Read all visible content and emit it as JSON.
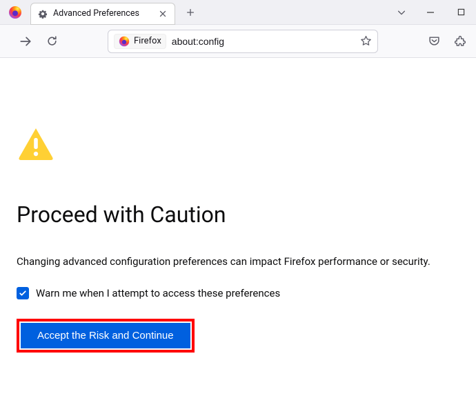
{
  "tab": {
    "title": "Advanced Preferences"
  },
  "urlbar": {
    "identity_label": "Firefox",
    "url": "about:config"
  },
  "page": {
    "heading": "Proceed with Caution",
    "description": "Changing advanced configuration preferences can impact Firefox performance or security.",
    "checkbox_label": "Warn me when I attempt to access these preferences",
    "button_label": "Accept the Risk and Continue"
  }
}
